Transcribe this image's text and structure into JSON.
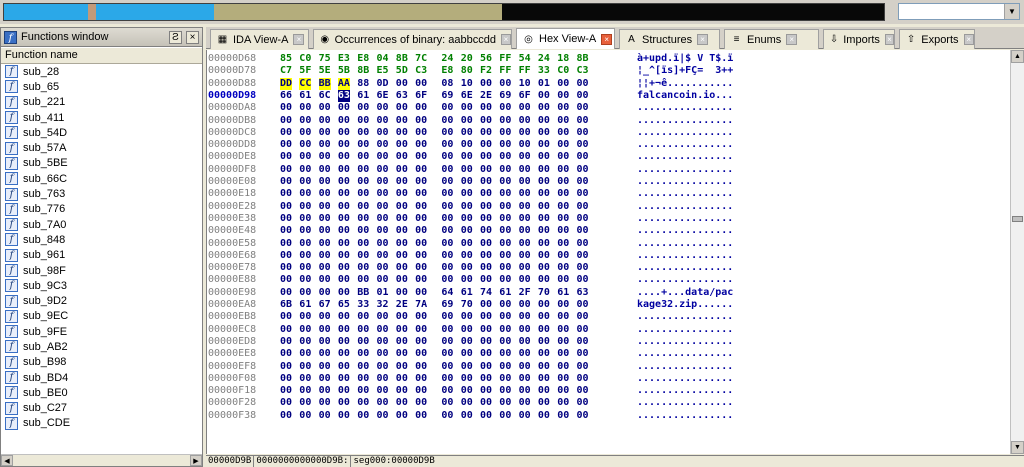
{
  "colors": {
    "nav_library": "#2ba8e8",
    "nav_function": "#c29a7a",
    "nav_data": "#b4ad7c",
    "nav_unexplored": "#080808",
    "hex_bytes": "#000080",
    "hex_green": "#008000",
    "hex_highlight": "#ffff00"
  },
  "functions_window": {
    "title": "Functions window",
    "header": "Function name",
    "dock_label": "Ƨ",
    "close_label": "×",
    "items": [
      "sub_28",
      "sub_65",
      "sub_221",
      "sub_411",
      "sub_54D",
      "sub_57A",
      "sub_5BE",
      "sub_66C",
      "sub_763",
      "sub_776",
      "sub_7A0",
      "sub_848",
      "sub_961",
      "sub_98F",
      "sub_9C3",
      "sub_9D2",
      "sub_9EC",
      "sub_9FE",
      "sub_AB2",
      "sub_B98",
      "sub_BD4",
      "sub_BE0",
      "sub_C27",
      "sub_CDE"
    ]
  },
  "tabs": [
    {
      "label": "IDA View-A",
      "icon": "ida-view-icon",
      "active": false
    },
    {
      "label": "Occurrences of binary: aabbccdd",
      "icon": "binoculars-icon",
      "active": false
    },
    {
      "label": "Hex View-A",
      "icon": "hex-view-icon",
      "active": true
    },
    {
      "label": "Structures",
      "icon": "structures-icon",
      "active": false
    },
    {
      "label": "Enums",
      "icon": "enums-icon",
      "active": false
    },
    {
      "label": "Imports",
      "icon": "imports-icon",
      "active": false
    },
    {
      "label": "Exports",
      "icon": "exports-icon",
      "active": false
    }
  ],
  "hex_rows": [
    {
      "addr": "00000D68",
      "bytes": [
        "85",
        "C0",
        "75",
        "E3",
        "E8",
        "04",
        "8B",
        "7C",
        "24",
        "20",
        "56",
        "FF",
        "54",
        "24",
        "18",
        "8B"
      ],
      "ascii": "à+upd.ï|$ V T$.ï",
      "green": true
    },
    {
      "addr": "00000D78",
      "bytes": [
        "C7",
        "5F",
        "5E",
        "5B",
        "8B",
        "E5",
        "5D",
        "C3",
        "E8",
        "80",
        "F2",
        "FF",
        "FF",
        "33",
        "C0",
        "C3"
      ],
      "ascii": "¦_^[ïs]+FÇ=  3++",
      "green": true
    },
    {
      "addr": "00000D88",
      "bytes": [
        "DD",
        "CC",
        "BB",
        "AA",
        "88",
        "0D",
        "00",
        "00",
        "08",
        "10",
        "00",
        "00",
        "10",
        "01",
        "00",
        "00"
      ],
      "ascii": "¦¦+¬ê...........",
      "highlight": [
        0,
        1,
        2,
        3
      ]
    },
    {
      "addr": "00000D98",
      "bytes": [
        "66",
        "61",
        "6C",
        "63",
        "61",
        "6E",
        "63",
        "6F",
        "69",
        "6E",
        "2E",
        "69",
        "6F",
        "00",
        "00",
        "00"
      ],
      "ascii": "falcancoin.io...",
      "current": true,
      "cursor": 3
    },
    {
      "addr": "00000DA8",
      "zero": true
    },
    {
      "addr": "00000DB8",
      "zero": true
    },
    {
      "addr": "00000DC8",
      "zero": true
    },
    {
      "addr": "00000DD8",
      "zero": true
    },
    {
      "addr": "00000DE8",
      "zero": true
    },
    {
      "addr": "00000DF8",
      "zero": true
    },
    {
      "addr": "00000E08",
      "zero": true
    },
    {
      "addr": "00000E18",
      "zero": true
    },
    {
      "addr": "00000E28",
      "zero": true
    },
    {
      "addr": "00000E38",
      "zero": true
    },
    {
      "addr": "00000E48",
      "zero": true
    },
    {
      "addr": "00000E58",
      "zero": true
    },
    {
      "addr": "00000E68",
      "zero": true
    },
    {
      "addr": "00000E78",
      "zero": true
    },
    {
      "addr": "00000E88",
      "zero": true
    },
    {
      "addr": "00000E98",
      "bytes": [
        "00",
        "00",
        "00",
        "00",
        "BB",
        "01",
        "00",
        "00",
        "64",
        "61",
        "74",
        "61",
        "2F",
        "70",
        "61",
        "63"
      ],
      "ascii": "....+...data/pac"
    },
    {
      "addr": "00000EA8",
      "bytes": [
        "6B",
        "61",
        "67",
        "65",
        "33",
        "32",
        "2E",
        "7A",
        "69",
        "70",
        "00",
        "00",
        "00",
        "00",
        "00",
        "00"
      ],
      "ascii": "kage32.zip......"
    },
    {
      "addr": "00000EB8",
      "zero": true
    },
    {
      "addr": "00000EC8",
      "zero": true
    },
    {
      "addr": "00000ED8",
      "zero": true
    },
    {
      "addr": "00000EE8",
      "zero": true
    },
    {
      "addr": "00000EF8",
      "zero": true
    },
    {
      "addr": "00000F08",
      "zero": true
    },
    {
      "addr": "00000F18",
      "zero": true
    },
    {
      "addr": "00000F28",
      "zero": true
    },
    {
      "addr": "00000F38",
      "zero": true
    }
  ],
  "status_bar": {
    "offset": "00000D9B",
    "address": "0000000000000D9B:",
    "location": "seg000:00000D9B"
  }
}
